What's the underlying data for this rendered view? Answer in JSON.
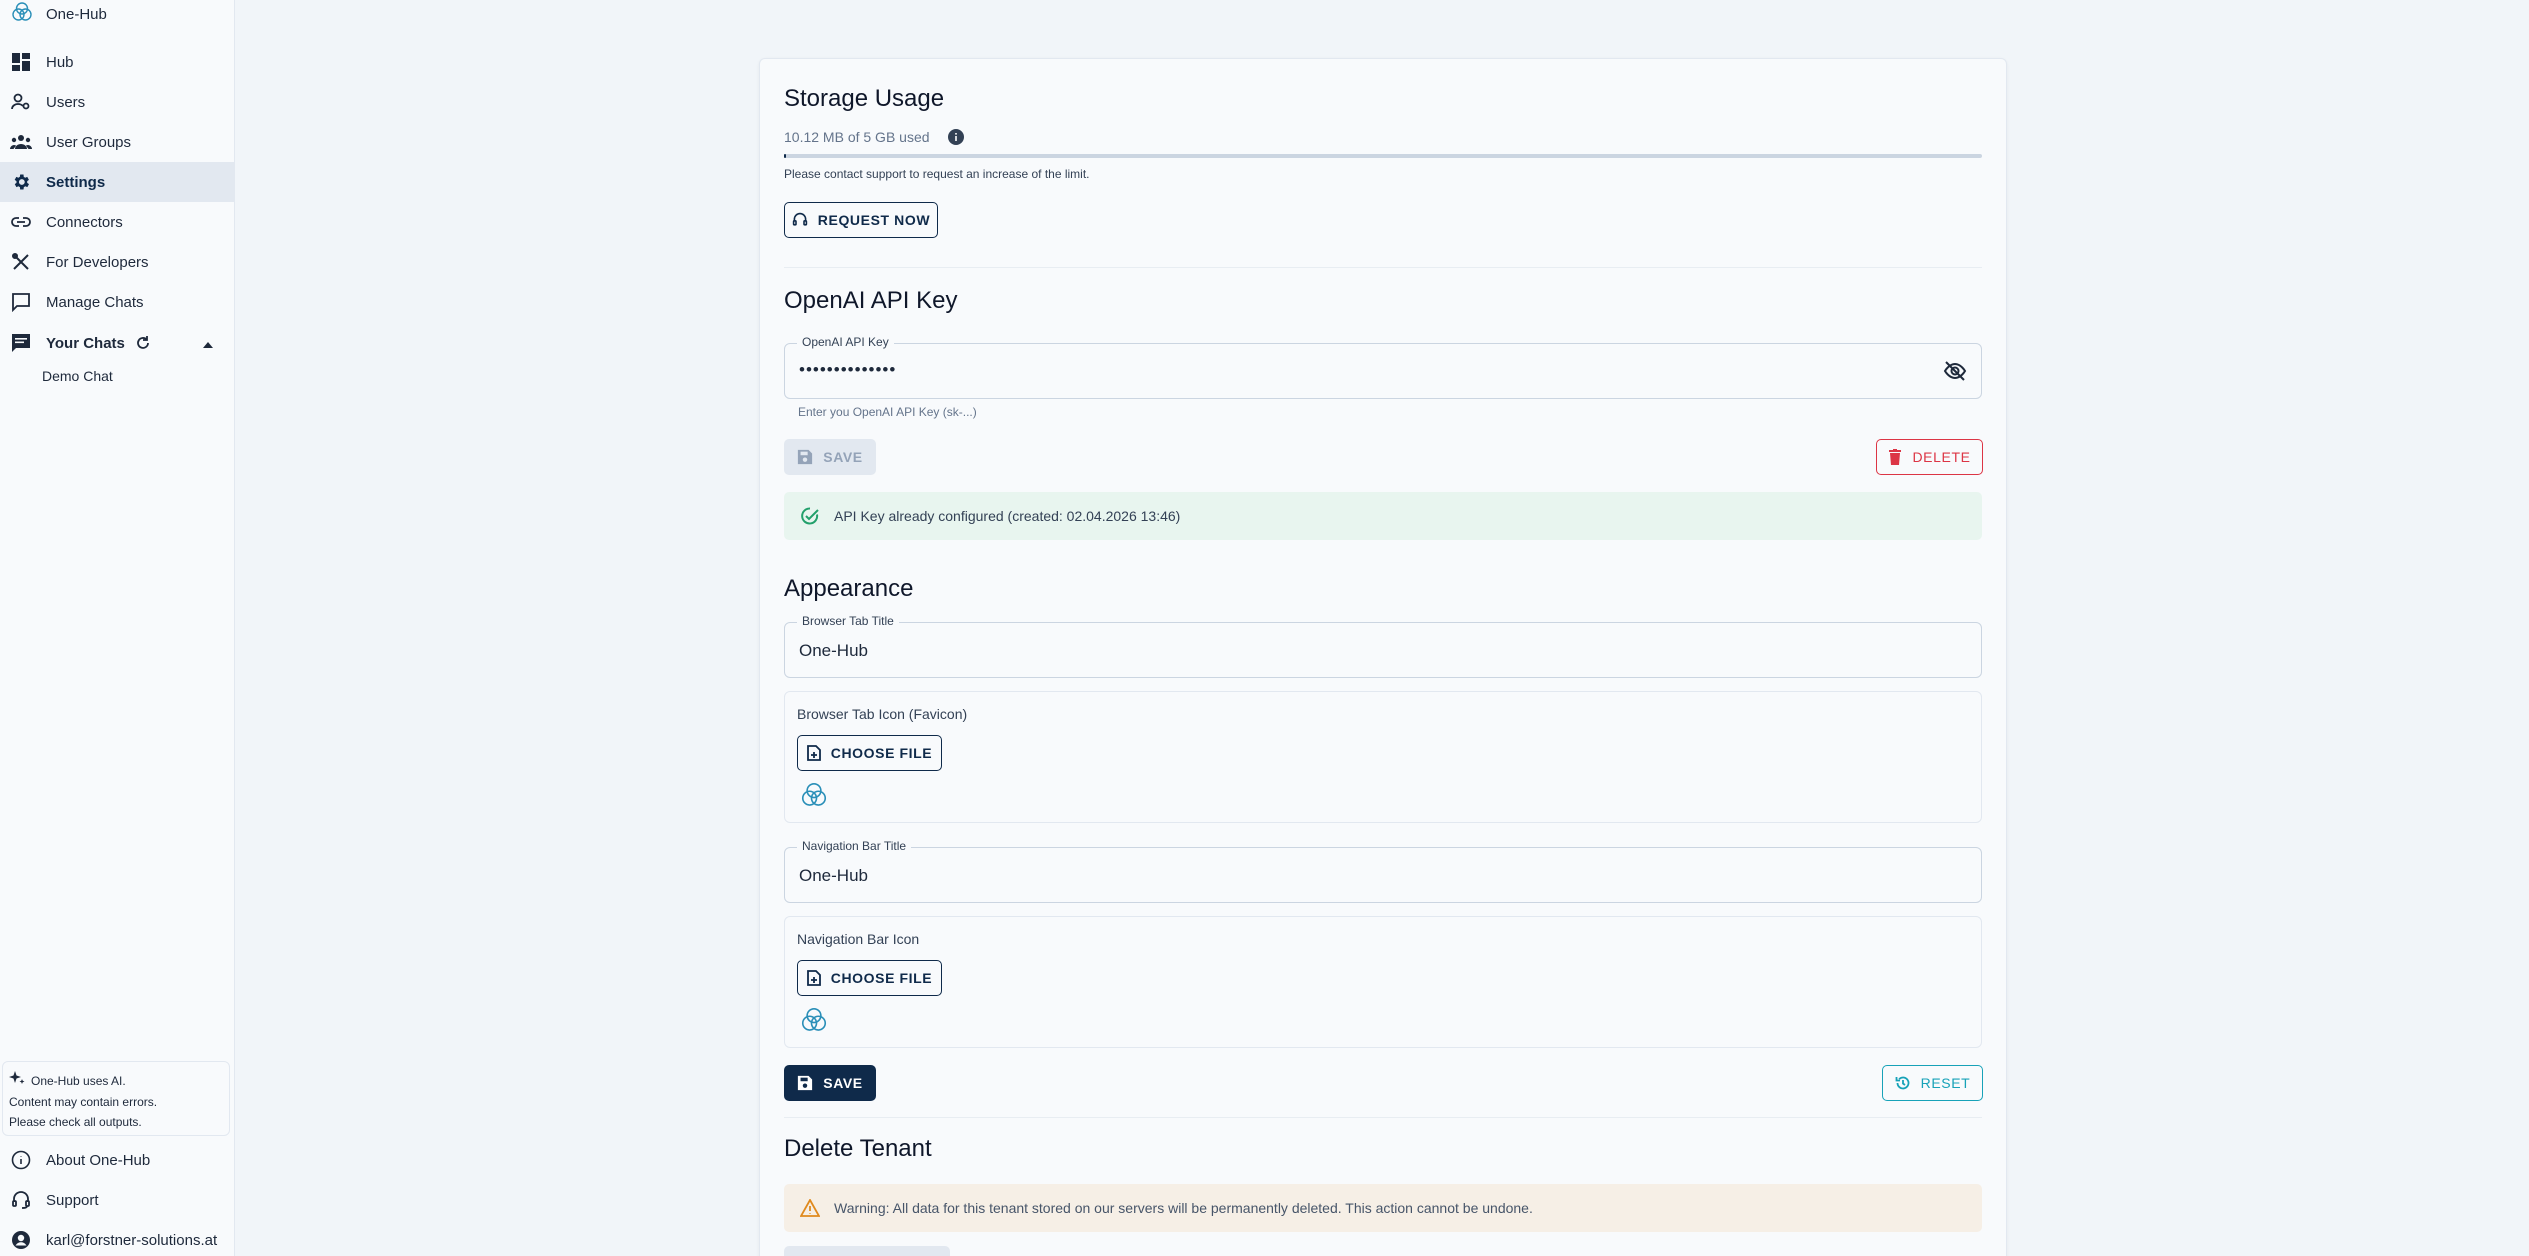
{
  "sidebar": {
    "brand": "One-Hub",
    "items": [
      {
        "label": "Hub",
        "icon": "dashboard-icon"
      },
      {
        "label": "Users",
        "icon": "user-settings-icon"
      },
      {
        "label": "User Groups",
        "icon": "groups-icon"
      },
      {
        "label": "Settings",
        "icon": "gear-icon"
      },
      {
        "label": "Connectors",
        "icon": "link-icon"
      },
      {
        "label": "For Developers",
        "icon": "tools-icon"
      },
      {
        "label": "Manage Chats",
        "icon": "chat-bubble-icon"
      }
    ],
    "your_chats": "Your Chats",
    "chats": [
      "Demo Chat"
    ],
    "ai_note": {
      "line1": "One-Hub uses AI.",
      "line2": "Content may contain errors.",
      "line3": "Please check all outputs."
    },
    "about": "About One-Hub",
    "support": "Support",
    "account": "karl@forstner-solutions.at"
  },
  "storage": {
    "title": "Storage Usage",
    "usage": "10.12 MB of 5 GB used",
    "note": "Please contact support to request an increase of the limit.",
    "request_button": "REQUEST NOW",
    "used_fraction": 0.002
  },
  "openai": {
    "title": "OpenAI API Key",
    "field_label": "OpenAI API Key",
    "field_value": "••••••••••••••",
    "helper": "Enter you OpenAI API Key (sk-...)",
    "save": "SAVE",
    "delete": "DELETE",
    "status": "API Key already configured (created: 02.04.2026 13:46)"
  },
  "appearance": {
    "title": "Appearance",
    "tab_title_label": "Browser Tab Title",
    "tab_title_value": "One-Hub",
    "favicon_label": "Browser Tab Icon (Favicon)",
    "choose_file": "CHOOSE FILE",
    "nav_title_label": "Navigation Bar Title",
    "nav_title_value": "One-Hub",
    "nav_icon_label": "Navigation Bar Icon",
    "save": "SAVE",
    "reset": "RESET"
  },
  "delete_tenant": {
    "title": "Delete Tenant",
    "warning": "Warning: All data for this tenant stored on our servers will be permanently deleted. This action cannot be undone."
  },
  "colors": {
    "primary": "#0f2a4a",
    "danger": "#dc3545",
    "success": "#22a06b",
    "teal": "#17a2b8",
    "warning": "#e08a1e"
  }
}
